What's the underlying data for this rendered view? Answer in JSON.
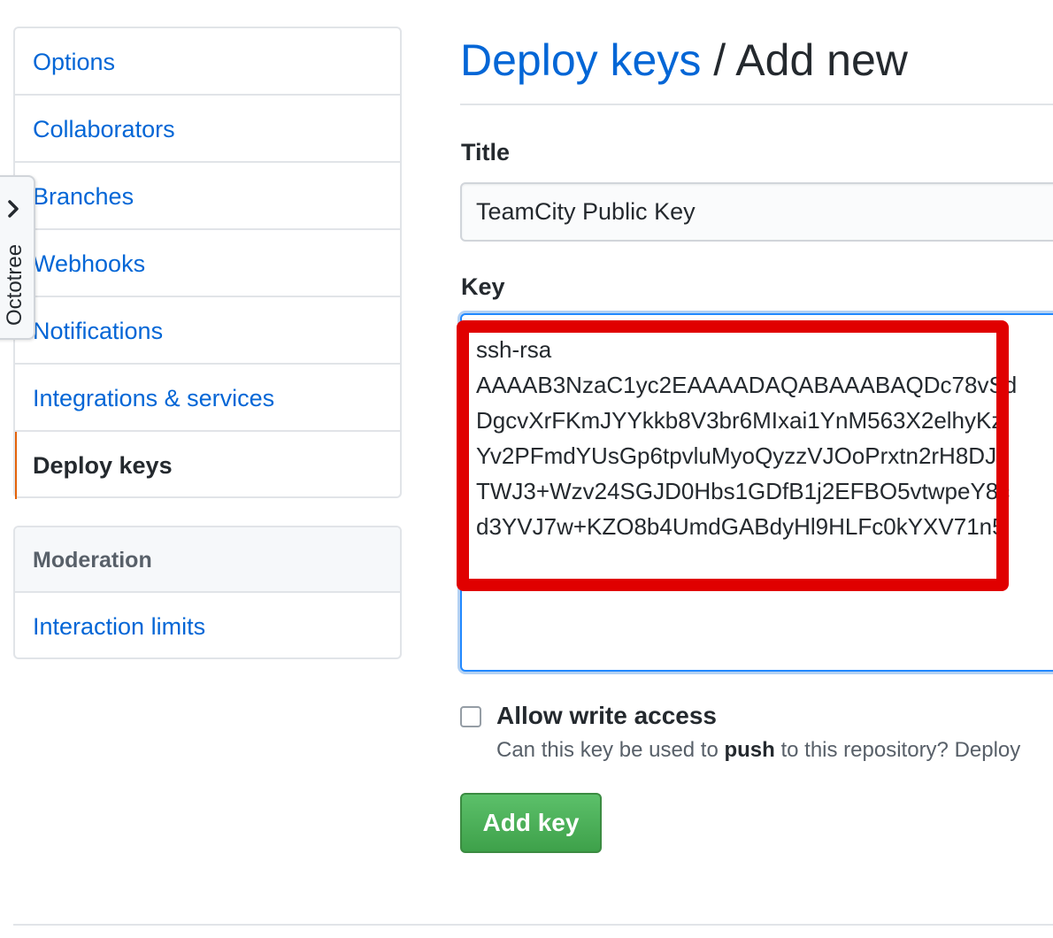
{
  "sidebar": {
    "items": [
      {
        "label": "Options"
      },
      {
        "label": "Collaborators"
      },
      {
        "label": "Branches"
      },
      {
        "label": "Webhooks"
      },
      {
        "label": "Notifications"
      },
      {
        "label": "Integrations & services"
      },
      {
        "label": "Deploy keys",
        "selected": true
      }
    ],
    "moderation": {
      "heading": "Moderation",
      "items": [
        {
          "label": "Interaction limits"
        }
      ]
    }
  },
  "octotree": {
    "label": "Octotree",
    "icon": "chevron-right-icon"
  },
  "header": {
    "breadcrumb_link": "Deploy keys",
    "separator": "/",
    "current": "Add new"
  },
  "form": {
    "title_label": "Title",
    "title_value": "TeamCity Public Key",
    "key_label": "Key",
    "key_lines": [
      "ssh-rsa",
      "AAAAB3NzaC1yc2EAAAADAQABAAABAQDc78vSd",
      "DgcvXrFKmJYYkkb8V3br6MIxai1YnM563X2elhyKz",
      "Yv2PFmdYUsGp6tpvluMyoQyzzVJOoPrxtn2rH8DJ",
      "TWJ3+Wzv24SGJD0Hbs1GDfB1j2EFBO5vtwpeY8c",
      "d3YVJ7w+KZO8b4UmdGABdyHl9HLFc0kYXV71n5"
    ],
    "write_access": {
      "label": "Allow write access",
      "checked": false,
      "note_prefix": "Can this key be used to ",
      "note_bold": "push",
      "note_suffix": " to this repository? Deploy"
    },
    "submit_label": "Add key"
  },
  "colors": {
    "link": "#0366d6",
    "selected_indicator": "#e36209",
    "highlight": "#e00000",
    "button_green": "#3ea14a"
  }
}
